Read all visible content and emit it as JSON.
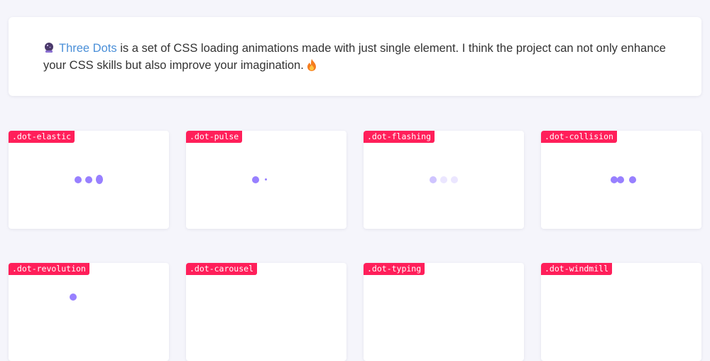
{
  "intro": {
    "link_text": "Three Dots",
    "text": " is a set of CSS loading animations made with just single element. I think the project can not only enhance your CSS skills but also improve your imagination.",
    "leading_icon": "crystal-ball-icon",
    "trailing_icon": "fire-icon"
  },
  "colors": {
    "dot": "#9880ff",
    "dot_light": "#ebe6ff",
    "tag_bg": "#ff1f5a",
    "link": "#4a8fd8"
  },
  "cards": [
    {
      "label": ".dot-elastic"
    },
    {
      "label": ".dot-pulse"
    },
    {
      "label": ".dot-flashing"
    },
    {
      "label": ".dot-collision"
    },
    {
      "label": ".dot-revolution"
    },
    {
      "label": ".dot-carousel"
    },
    {
      "label": ".dot-typing"
    },
    {
      "label": ".dot-windmill"
    }
  ]
}
